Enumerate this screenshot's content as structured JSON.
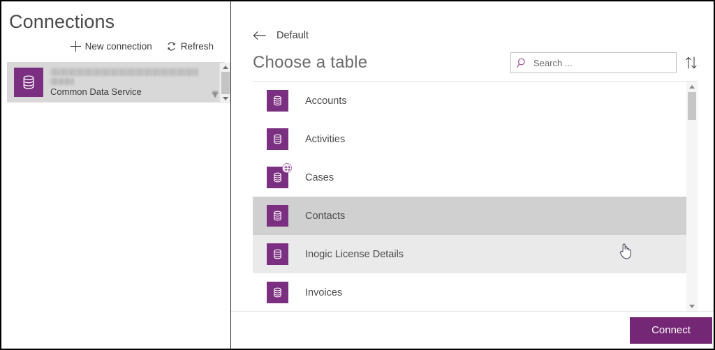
{
  "sidebar": {
    "title": "Connections",
    "commands": [
      {
        "label": "New connection",
        "icon": "plus-icon"
      },
      {
        "label": "Refresh",
        "icon": "refresh-icon"
      }
    ],
    "connection": {
      "name_redacted": "",
      "name_redacted_line2": "",
      "subtitle": "Common Data Service",
      "badge_icon": "gem-icon",
      "logo_icon": "database-icon",
      "selected": true
    },
    "scrollbar": {
      "up_icon": "chevron-up-icon",
      "down_icon": "chevron-down-icon"
    }
  },
  "panel": {
    "back": {
      "icon": "back-arrow-icon",
      "label": "Default"
    },
    "title": "Choose a table",
    "search": {
      "placeholder": "Search ...",
      "value": "",
      "icon": "search-icon"
    },
    "sort": {
      "icon": "sort-ascending-descending-icon"
    },
    "list": [
      {
        "label": "Accounts",
        "icon": "database-icon",
        "state": "normal",
        "badge": false
      },
      {
        "label": "Activities",
        "icon": "database-icon",
        "state": "normal",
        "badge": false
      },
      {
        "label": "Cases",
        "icon": "database-icon",
        "state": "normal",
        "badge": true,
        "badge_icon": "globe-icon"
      },
      {
        "label": "Contacts",
        "icon": "database-icon",
        "state": "selected",
        "badge": false
      },
      {
        "label": "Inogic License Details",
        "icon": "database-icon",
        "state": "hovered",
        "badge": false
      },
      {
        "label": "Invoices",
        "icon": "database-icon",
        "state": "normal",
        "badge": false
      }
    ],
    "scrollbar": {
      "up_icon": "chevron-up-icon",
      "down_icon": "chevron-down-icon"
    },
    "footer": {
      "connect_label": "Connect"
    }
  },
  "colors": {
    "brand_purple": "#7b2f80",
    "button_purple": "#742774",
    "selected_row": "#d0d0d0",
    "hovered_row": "#eaeaea",
    "connection_card": "#d8d8d8",
    "text_primary": "#4b4b4b",
    "text_muted": "#6b6b6b"
  }
}
